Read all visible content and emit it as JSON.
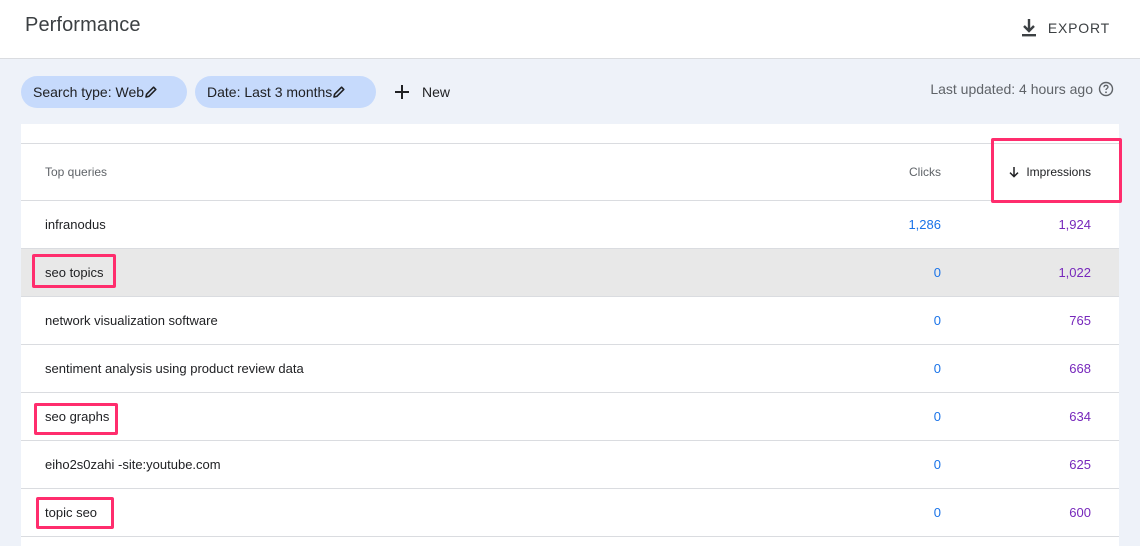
{
  "header": {
    "title": "Performance",
    "export_label": "EXPORT"
  },
  "filters": {
    "search_type": "Search type: Web",
    "date": "Date: Last 3 months",
    "new_label": "New",
    "last_updated": "Last updated: 4 hours ago"
  },
  "table": {
    "columns": {
      "query": "Top queries",
      "clicks": "Clicks",
      "impressions": "Impressions"
    },
    "sort": "impressions-descending",
    "rows": [
      {
        "query": "infranodus",
        "clicks": "1,286",
        "impressions": "1,924"
      },
      {
        "query": "seo topics",
        "clicks": "0",
        "impressions": "1,022"
      },
      {
        "query": "network visualization software",
        "clicks": "0",
        "impressions": "765"
      },
      {
        "query": "sentiment analysis using product review data",
        "clicks": "0",
        "impressions": "668"
      },
      {
        "query": "seo graphs",
        "clicks": "0",
        "impressions": "634"
      },
      {
        "query": "eiho2s0zahi -site:youtube.com",
        "clicks": "0",
        "impressions": "625"
      },
      {
        "query": "topic seo",
        "clicks": "0",
        "impressions": "600"
      }
    ]
  },
  "colors": {
    "clicks": "#1a73e8",
    "impressions": "#7627bb",
    "chip": "#c6dafc",
    "annotation": "#ff2d6d",
    "row_hover": "#e8e8e8"
  },
  "icons": [
    "download-icon",
    "edit-pencil-icon",
    "plus-icon",
    "help-circle-icon",
    "arrow-down-icon"
  ]
}
